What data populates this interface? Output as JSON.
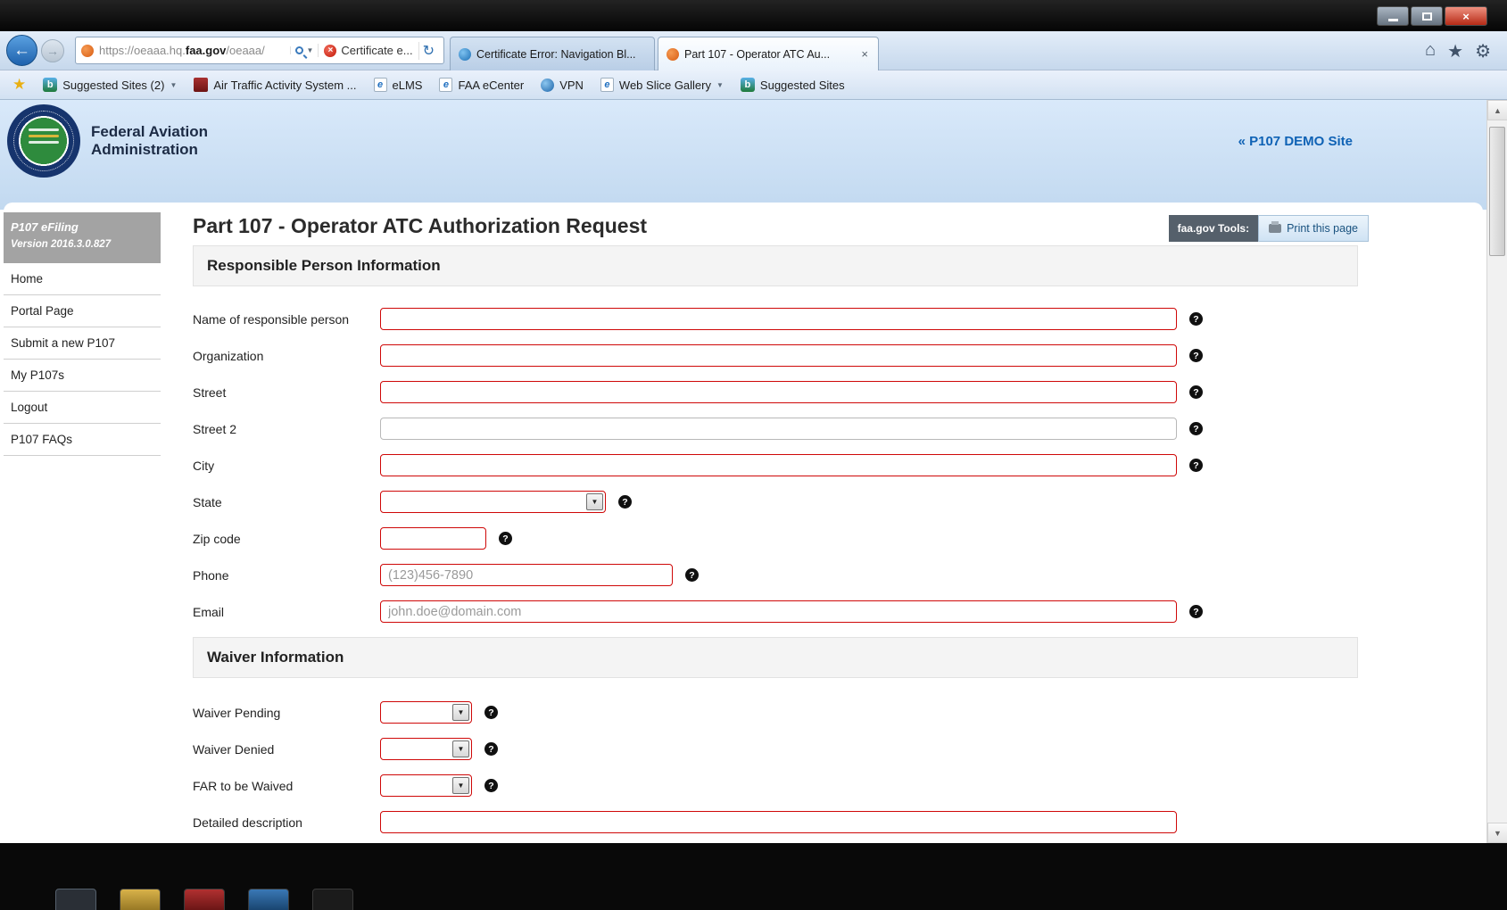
{
  "icons": {
    "back": "←",
    "forward": "→",
    "refresh": "↻",
    "caret_down": "▼",
    "close": "×",
    "home": "⌂",
    "star": "★",
    "gear": "⚙",
    "help": "?",
    "scroll_up": "▲",
    "scroll_down": "▼",
    "suggested_b": "b",
    "ie_e": "e"
  },
  "browser": {
    "address": {
      "url_prefix": "https://oeaaa.hq.",
      "url_domain": "faa.gov",
      "url_suffix": "/oeaaa/",
      "security_warning": "Certificate e..."
    },
    "tabs": [
      {
        "title": "Certificate Error: Navigation Bl..."
      },
      {
        "title": "Part 107 - Operator ATC Au..."
      }
    ],
    "favorites": [
      {
        "label": "Suggested Sites (2)"
      },
      {
        "label": "Air Traffic Activity System ..."
      },
      {
        "label": "eLMS"
      },
      {
        "label": "FAA eCenter"
      },
      {
        "label": "VPN"
      },
      {
        "label": "Web Slice Gallery"
      },
      {
        "label": "Suggested Sites"
      }
    ]
  },
  "site_header": {
    "org_name_line1": "Federal Aviation",
    "org_name_line2": "Administration",
    "demo_link": "« P107 DEMO Site"
  },
  "sidebar": {
    "app_title": "P107 eFiling",
    "app_version": "Version 2016.3.0.827",
    "items": [
      {
        "label": "Home"
      },
      {
        "label": "Portal Page"
      },
      {
        "label": "Submit a new P107"
      },
      {
        "label": "My P107s"
      },
      {
        "label": "Logout"
      },
      {
        "label": "P107 FAQs"
      }
    ]
  },
  "main": {
    "page_title": "Part 107 - Operator ATC Authorization Request",
    "tools_label": "faa.gov Tools:",
    "print_button": "Print this page",
    "section_responsible": "Responsible Person Information",
    "section_waiver": "Waiver Information",
    "fields": {
      "name_label": "Name of responsible person",
      "organization_label": "Organization",
      "street_label": "Street",
      "street2_label": "Street 2",
      "city_label": "City",
      "state_label": "State",
      "zip_label": "Zip code",
      "phone_label": "Phone",
      "phone_placeholder": "(123)456-7890",
      "email_label": "Email",
      "email_placeholder": "john.doe@domain.com",
      "waiver_pending_label": "Waiver Pending",
      "waiver_denied_label": "Waiver Denied",
      "far_waived_label": "FAR to be Waived",
      "detailed_description_label": "Detailed description"
    }
  }
}
